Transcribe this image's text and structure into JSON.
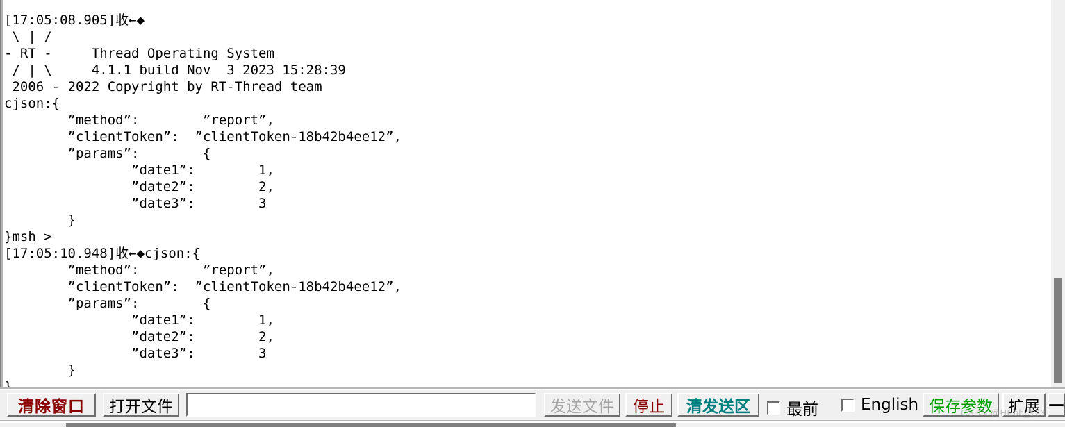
{
  "terminal": {
    "text": "[17:05:08.905]收←◆\n \\ | /\n- RT -     Thread Operating System\n / | \\     4.1.1 build Nov  3 2023 15:28:39\n 2006 - 2022 Copyright by RT-Thread team\ncjson:{\n        ”method”:        ”report”,\n        ”clientToken”:  ”clientToken-18b42b4ee12”,\n        ”params”:        {\n                ”date1”:        1,\n                ”date2”:        2,\n                ”date3”:        3\n        }\n}msh >\n[17:05:10.948]收←◆cjson:{\n        ”method”:        ”report”,\n        ”clientToken”:  ”clientToken-18b42b4ee12”,\n        ”params”:        {\n                ”date1”:        1,\n                ”date2”:        2,\n                ”date3”:        3\n        }\n}",
    "lines": [
      "[17:05:08.905]收←◆",
      " \\ | /",
      "- RT -     Thread Operating System",
      " / | \\     4.1.1 build Nov  3 2023 15:28:39",
      " 2006 - 2022 Copyright by RT-Thread team",
      "cjson:{",
      "        ”method”:        ”report”,",
      "        ”clientToken”:  ”clientToken-18b42b4ee12”,",
      "        ”params”:        {",
      "                ”date1”:        1,",
      "                ”date2”:        2,",
      "                ”date3”:        3",
      "        }",
      "}msh >",
      "[17:05:10.948]收←◆cjson:{",
      "        ”method”:        ”report”,",
      "        ”clientToken”:  ”clientToken-18b42b4ee12”,",
      "        ”params”:        {",
      "                ”date1”:        1,",
      "                ”date2”:        2,",
      "                ”date3”:        3",
      "        }",
      "}"
    ],
    "timestamps": [
      "[17:05:08.905]",
      "[17:05:10.948]"
    ],
    "rt_thread_banner": {
      "line1": "- RT -     Thread Operating System",
      "line2": " / | \\     4.1.1 build Nov  3 2023 15:28:39",
      "line3": " 2006 - 2022 Copyright by RT-Thread team",
      "version": "4.1.1",
      "build_date": "Nov  3 2023 15:28:39",
      "copyright_years": "2006 - 2022"
    },
    "json_payload": {
      "method": "report",
      "clientToken": "clientToken-18b42b4ee12",
      "params": {
        "date1": 1,
        "date2": 2,
        "date3": 3
      }
    },
    "prompt": "msh >"
  },
  "toolbar": {
    "clear_window_label": "清除窗口",
    "open_file_label": "打开文件",
    "send_file_label": "发送文件",
    "stop_label": "停止",
    "clear_send_label": "清发送区",
    "top_checkbox_label": "最前",
    "english_checkbox_label": "English",
    "save_params_label": "保存参数",
    "expand_label": "扩展",
    "minimize_label": "—",
    "send_input_value": "",
    "send_input_placeholder": ""
  },
  "watermark": {
    "text": "CSDN @HEbb_123"
  },
  "colors": {
    "clear_window": "#8b0000",
    "stop": "#8b0000",
    "clear_send": "#008080",
    "save_params": "#00a000",
    "send_file_disabled": "#a6a6a6",
    "terminal_bg": "#ffffff",
    "terminal_fg": "#000000",
    "panel_bg": "#f0f0f0"
  }
}
